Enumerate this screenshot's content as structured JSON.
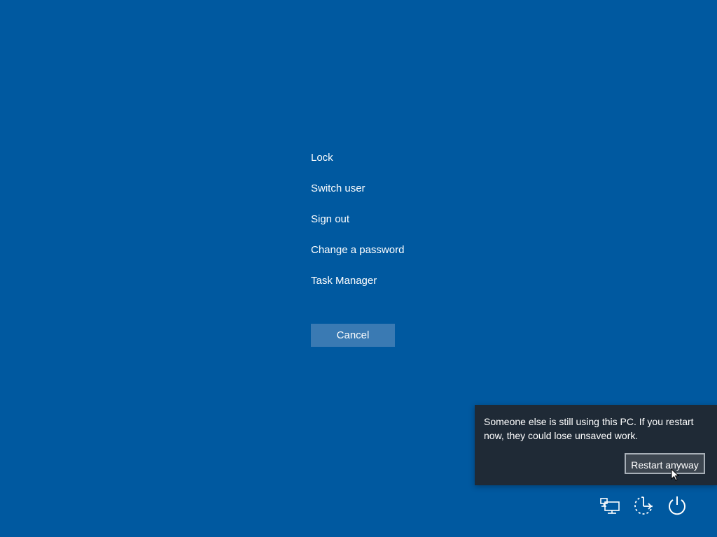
{
  "menu": {
    "items": [
      {
        "label": "Lock"
      },
      {
        "label": "Switch user"
      },
      {
        "label": "Sign out"
      },
      {
        "label": "Change a password"
      },
      {
        "label": "Task Manager"
      }
    ]
  },
  "cancel_button": {
    "label": "Cancel"
  },
  "restart_flyout": {
    "message": "Someone else is still using this PC. If you restart now, they could lose unsaved work.",
    "button_label": "Restart anyway"
  },
  "tray": {
    "icons": [
      "network-icon",
      "ease-of-access-icon",
      "power-icon"
    ]
  },
  "colors": {
    "background": "#0059a0",
    "cancel_button": "#3a7ab3",
    "flyout_background": "#1f2a36",
    "text": "#ffffff"
  }
}
